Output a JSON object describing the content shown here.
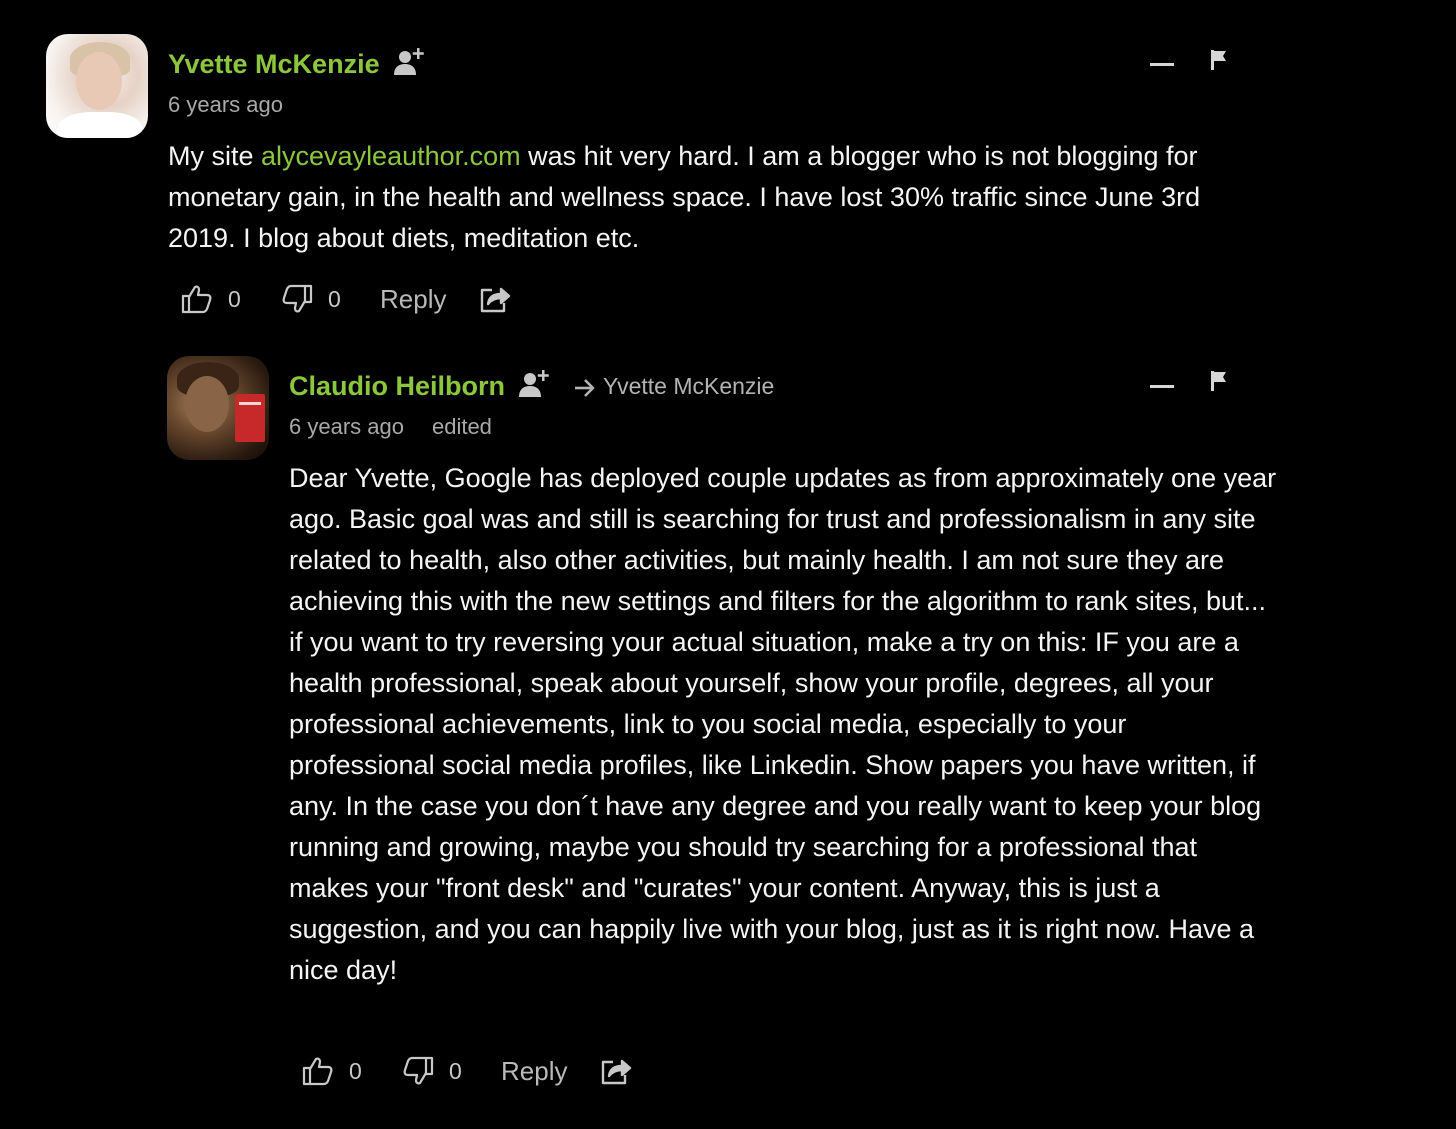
{
  "colors": {
    "background": "#000000",
    "author_name": "#8cc63f",
    "link": "#8cc63f",
    "text": "#f4f4f4",
    "muted": "#a8a8a8"
  },
  "comments": [
    {
      "author": "Yvette McKenzie",
      "timestamp": "6 years ago",
      "body_prefix": "My site ",
      "body_link": "alycevayleauthor.com",
      "body_suffix": " was hit very hard. I am a blogger who is not blogging for monetary gain, in the health and wellness space. I have lost 30% traffic since June 3rd 2019. I blog about diets, meditation etc.",
      "upvotes": "0",
      "downvotes": "0",
      "reply_label": "Reply",
      "icons": {
        "follow": "add-user-icon",
        "collapse": "collapse-icon",
        "flag": "flag-icon",
        "upvote": "thumbs-up-icon",
        "downvote": "thumbs-down-icon",
        "share": "share-icon"
      }
    },
    {
      "author": "Claudio Heilborn",
      "replying_to": "Yvette McKenzie",
      "timestamp": "6 years ago",
      "edited_label": "edited",
      "body": "Dear Yvette, Google has deployed couple updates as from approximately one year ago. Basic goal was and still is searching for trust and professionalism in any site related to health, also other activities, but mainly health. I am not sure they are achieving this with the new settings and filters for the algorithm to rank sites, but... if you want to try reversing your actual situation, make a try on this: IF you are a health professional, speak about yourself, show your profile, degrees, all your professional achievements, link to you social media, especially to your professional social media profiles, like Linkedin. Show papers you have written, if any. In the case you don´t have any degree and you really want to keep your blog running and growing, maybe you should try searching for a professional that makes your \"front desk\" and \"curates\" your content. Anyway, this is just a suggestion, and you can happily live with your blog, just as it is right now. Have a nice day!",
      "upvotes": "0",
      "downvotes": "0",
      "reply_label": "Reply",
      "icons": {
        "follow": "add-user-icon",
        "reply_to": "arrow-right-icon",
        "collapse": "collapse-icon",
        "flag": "flag-icon",
        "upvote": "thumbs-up-icon",
        "downvote": "thumbs-down-icon",
        "share": "share-icon"
      }
    }
  ]
}
